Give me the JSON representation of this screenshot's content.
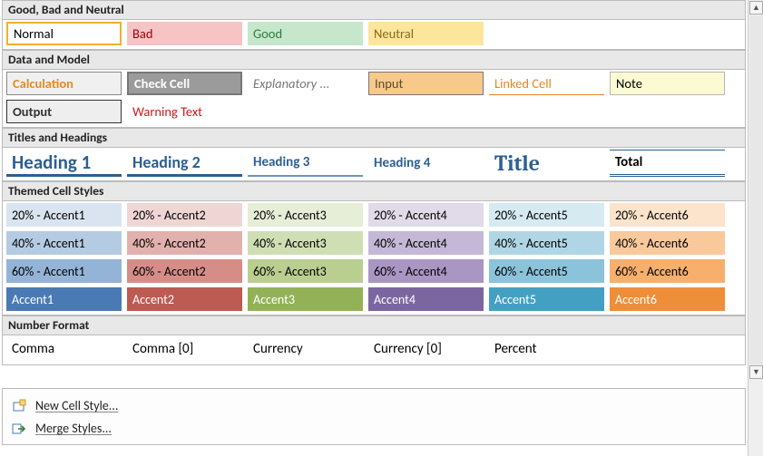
{
  "sections": {
    "gbn": {
      "header": "Good, Bad and Neutral",
      "items": {
        "normal": "Normal",
        "bad": "Bad",
        "good": "Good",
        "neutral": "Neutral"
      }
    },
    "dm": {
      "header": "Data and Model",
      "items": {
        "calc": "Calculation",
        "check": "Check Cell",
        "expl": "Explanatory ...",
        "input": "Input",
        "linked": "Linked Cell",
        "note": "Note",
        "output": "Output",
        "warn": "Warning Text"
      }
    },
    "th": {
      "header": "Titles and Headings",
      "items": {
        "h1": "Heading 1",
        "h2": "Heading 2",
        "h3": "Heading 3",
        "h4": "Heading 4",
        "title": "Title",
        "total": "Total"
      }
    },
    "tc": {
      "header": "Themed Cell Styles",
      "pct": [
        "20%",
        "40%",
        "60%"
      ],
      "accent_word": "Accent",
      "accents": [
        {
          "n": 1,
          "c20": "#d9e4f0",
          "c40": "#b5cbe3",
          "c60": "#93b4d6",
          "c100": "#4a7ab3"
        },
        {
          "n": 2,
          "c20": "#efd6d4",
          "c40": "#e2b1ae",
          "c60": "#d68d88",
          "c100": "#bd5a51"
        },
        {
          "n": 3,
          "c20": "#e6eed7",
          "c40": "#d0deb3",
          "c60": "#bace8f",
          "c100": "#93b257"
        },
        {
          "n": 4,
          "c20": "#e0dae9",
          "c40": "#c4b8d6",
          "c60": "#a996c3",
          "c100": "#7b66a0"
        },
        {
          "n": 5,
          "c20": "#d6eaf2",
          "c40": "#b0d6e6",
          "c60": "#8bc3da",
          "c100": "#44a0c2"
        },
        {
          "n": 6,
          "c20": "#fce3cc",
          "c40": "#f9c99c",
          "c60": "#f6af6d",
          "c100": "#ef8e39"
        }
      ]
    },
    "nf": {
      "header": "Number Format",
      "items": {
        "comma": "Comma",
        "comma0": "Comma [0]",
        "currency": "Currency",
        "currency0": "Currency [0]",
        "percent": "Percent"
      }
    }
  },
  "footer": {
    "new_style": "New Cell Style...",
    "merge_styles": "Merge Styles..."
  }
}
